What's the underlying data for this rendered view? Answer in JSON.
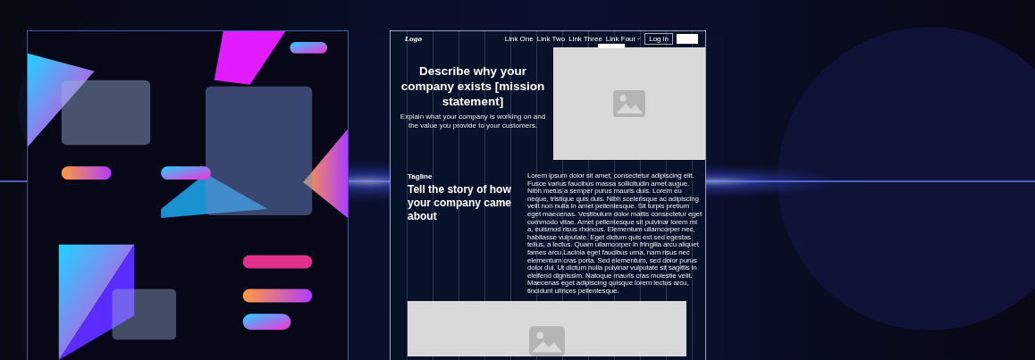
{
  "wireframe": {
    "nav": {
      "logo": "Logo",
      "links": [
        {
          "label": "Link One",
          "dropdown": false
        },
        {
          "label": "Link Two",
          "dropdown": false
        },
        {
          "label": "Link Three",
          "dropdown": false
        },
        {
          "label": "Link Four",
          "dropdown": true
        }
      ],
      "login": "Log in",
      "dropdown_open": true
    },
    "hero": {
      "heading": "Describe why your company exists [mission statement]",
      "text": "Explain what your company is working on and the value you provide to your customers."
    },
    "story": {
      "tagline": "Tagline",
      "heading": "Tell the story of how your company came about",
      "body": "Lorem ipsum dolor sit amet, consectetur adipiscing elit. Fusce varius faucibus massa sollicitudin amet augue. Nibh metus a semper purus mauris duis. Lorem eu neque, tristique quis duis. Nibh scelerisque ac adipiscing velit non nulla in amet pellentesque. Sit turpis pretium eget maecenas. Vestibulum dolor mattis consectetur eget commodo vitae. Amet pellentesque sit pulvinar lorem mi a, euismod risus rhoncus. Elementum ullamcorper nec, habitasse vulputate. Eget dictum quis est sed egestas tellus, a lectus. Quam ullamcorper in fringilla arcu aliquet fames arcu.Lacinia eget faucibus urna, nam risus nec elementum cras porta. Sed elementum, sed dolor purus dolor dui. Ut dictum nulla pulvinar vulputate sit sagittis in eleifend dignissim. Natoque mauris cras molestie velit. Maecenas eget adipiscing quisque lorem lectus arcu, tincidunt ultrices pellentesque."
    }
  }
}
